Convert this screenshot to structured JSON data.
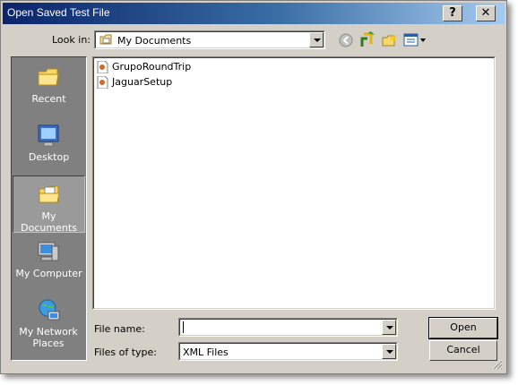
{
  "window": {
    "title": "Open Saved Test File",
    "help_label": "?",
    "close_label": "✕"
  },
  "lookin": {
    "label": "Look in:",
    "value": "My Documents"
  },
  "places": [
    {
      "label": "Recent",
      "icon": "recent-folder-icon"
    },
    {
      "label": "Desktop",
      "icon": "desktop-icon"
    },
    {
      "label": "My Documents",
      "icon": "my-documents-folder-icon",
      "selected": true
    },
    {
      "label": "My Computer",
      "icon": "my-computer-icon"
    },
    {
      "label": "My Network Places",
      "icon": "network-places-icon"
    }
  ],
  "files": [
    {
      "name": "GrupoRoundTrip"
    },
    {
      "name": "JaguarSetup"
    }
  ],
  "filename": {
    "label": "File name:",
    "value": ""
  },
  "filetype": {
    "label": "Files of type:",
    "value": "XML Files"
  },
  "buttons": {
    "open": "Open",
    "cancel": "Cancel"
  },
  "colors": {
    "title_start": "#0a246a",
    "title_end": "#a6caf0",
    "face": "#d4d0c8",
    "places_bg": "#808080"
  }
}
